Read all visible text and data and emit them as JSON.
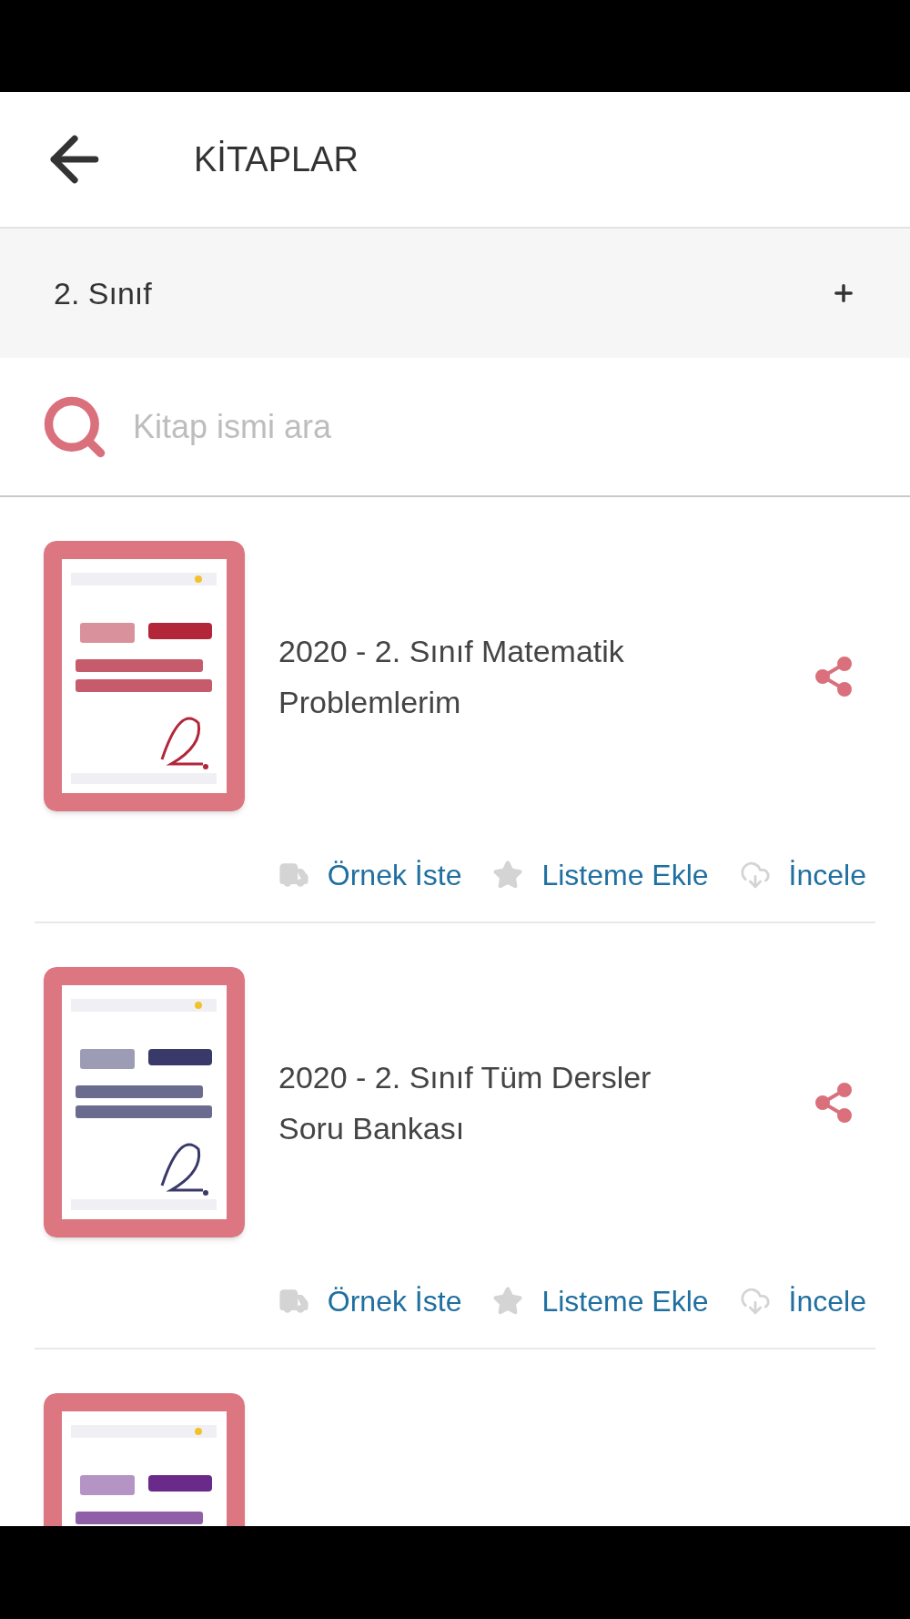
{
  "header": {
    "title": "KİTAPLAR"
  },
  "category": {
    "label": "2. Sınıf",
    "expanded": false
  },
  "search": {
    "placeholder": "Kitap ismi ara"
  },
  "books": [
    {
      "cover": {
        "kind": "picture"
      },
      "title": "2020 - 2. Sınıf Matematik Problemlerim",
      "actions": [
        {
          "kind": "sample",
          "label": "Örnek İste"
        },
        {
          "kind": "list",
          "label": "Listeme Ekle"
        },
        {
          "kind": "review",
          "label": "İncele"
        }
      ]
    },
    {
      "cover": {
        "kind": "picture"
      },
      "title": "2020 - 2. Sınıf Tüm Dersler Soru Bankası",
      "actions": [
        {
          "kind": "sample",
          "label": "Örnek İste"
        },
        {
          "kind": "list",
          "label": "Listeme Ekle"
        },
        {
          "kind": "review",
          "label": "İncele"
        }
      ]
    },
    {
      "cover": {
        "kind": "picture"
      }
    }
  ]
}
